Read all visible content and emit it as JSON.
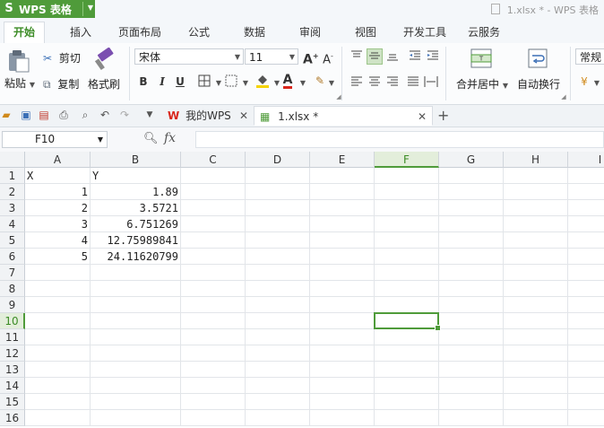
{
  "app": {
    "name": "WPS 表格",
    "window_title": "1.xlsx * - WPS 表格"
  },
  "menu": {
    "tabs": [
      "开始",
      "插入",
      "页面布局",
      "公式",
      "数据",
      "审阅",
      "视图",
      "开发工具",
      "云服务"
    ],
    "active": "开始"
  },
  "ribbon": {
    "paste_label": "粘贴",
    "cut_label": "剪切",
    "copy_label": "复制",
    "format_painter_label": "格式刷",
    "font_name": "宋体",
    "font_size": "11",
    "merge_center_label": "合并居中",
    "wrap_text_label": "自动换行",
    "number_format": "常规",
    "bold_label": "B",
    "italic_label": "I",
    "underline_label": "U",
    "font_color": "#d9261c",
    "fill_color": "#f5d300"
  },
  "tabs": {
    "home_tab_label": "我的WPS",
    "file_tab_label": "1.xlsx *",
    "add_tab_symbol": "+"
  },
  "formula_bar": {
    "cell_ref": "F10",
    "fx_label": "fx",
    "value": ""
  },
  "sheet": {
    "columns": [
      "A",
      "B",
      "C",
      "D",
      "E",
      "F",
      "G",
      "H",
      "I"
    ],
    "rows": [
      "1",
      "2",
      "3",
      "4",
      "5",
      "6",
      "7",
      "8",
      "9",
      "10",
      "11",
      "12",
      "13",
      "14",
      "15",
      "16"
    ],
    "selected_column": "F",
    "selected_row": "10",
    "cells": {
      "A1": "X",
      "B1": "Y",
      "A2": "1",
      "B2": "1.89",
      "A3": "2",
      "B3": "3.5721",
      "A4": "3",
      "B4": "6.751269",
      "A5": "4",
      "B5": "12.75989841",
      "A6": "5",
      "B6": "24.11620799"
    }
  },
  "colors": {
    "accent": "#4f9b3a",
    "selection_header_bg": "#e3eedb"
  }
}
